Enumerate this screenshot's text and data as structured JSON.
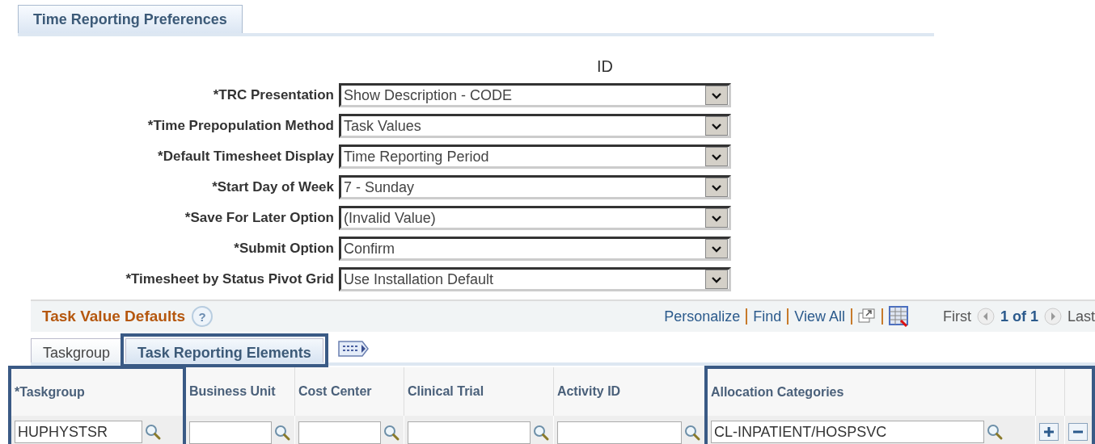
{
  "page_tab": {
    "label": "Time Reporting Preferences"
  },
  "id_label": "ID",
  "fields": [
    {
      "label": "*TRC Presentation",
      "value": "Show Description - CODE"
    },
    {
      "label": "*Time Prepopulation Method",
      "value": "Task Values"
    },
    {
      "label": "*Default Timesheet Display",
      "value": "Time Reporting Period"
    },
    {
      "label": "*Start Day of Week",
      "value": "7 - Sunday"
    },
    {
      "label": "*Save For Later Option",
      "value": "(Invalid Value)"
    },
    {
      "label": "*Submit Option",
      "value": "Confirm"
    },
    {
      "label": "*Timesheet by Status Pivot Grid",
      "value": "Use Installation Default"
    }
  ],
  "grid": {
    "title": "Task Value Defaults",
    "help": "?",
    "links": [
      "Personalize",
      "Find",
      "View All"
    ],
    "pager": {
      "first": "First",
      "count": "1 of 1",
      "last": "Last"
    },
    "tabs": [
      {
        "label": "Taskgroup",
        "selected": false,
        "highlighted": false
      },
      {
        "label": "Task Reporting Elements",
        "selected": true,
        "highlighted": true
      }
    ],
    "columns": [
      {
        "kind": "lookup",
        "label": "*Taskgroup",
        "value": "HUPHYSTSR",
        "highlighted": true
      },
      {
        "kind": "lookup",
        "label": "Business Unit",
        "highlighted": false
      },
      {
        "kind": "lookup",
        "label": "Cost Center",
        "highlighted": false
      },
      {
        "kind": "lookup",
        "label": "Clinical Trial",
        "highlighted": false
      },
      {
        "kind": "lookup",
        "label": "Activity ID",
        "highlighted": false
      },
      {
        "kind": "lookup",
        "label": "Allocation Categories",
        "value": "CL-INPATIENT/HOSPSVC",
        "highlighted": true
      },
      {
        "kind": "add",
        "highlighted": true
      },
      {
        "kind": "remove",
        "highlighted": true
      }
    ]
  }
}
